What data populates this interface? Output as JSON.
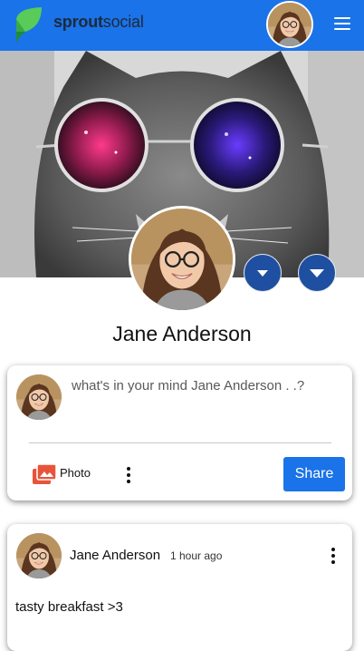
{
  "header": {
    "brand_bold": "sprout",
    "brand_regular": "social",
    "colors": {
      "bar": "#1a73e8",
      "leaf_light": "#59cb59",
      "leaf_dark": "#1f8b3a"
    }
  },
  "profile": {
    "name": "Jane Anderson",
    "cover_icon": "cat-with-galaxy-sunglasses-photo",
    "avatar_icon": "woman-with-glasses-photo",
    "action_buttons": [
      "chevron-down-icon",
      "chevron-down-icon"
    ]
  },
  "composer": {
    "placeholder": "what's in your mind Jane Anderson . .?",
    "photo_label": "Photo",
    "share_label": "Share"
  },
  "posts": [
    {
      "author": "Jane Anderson",
      "time": "1 hour ago",
      "text": "tasty breakfast >3"
    }
  ]
}
